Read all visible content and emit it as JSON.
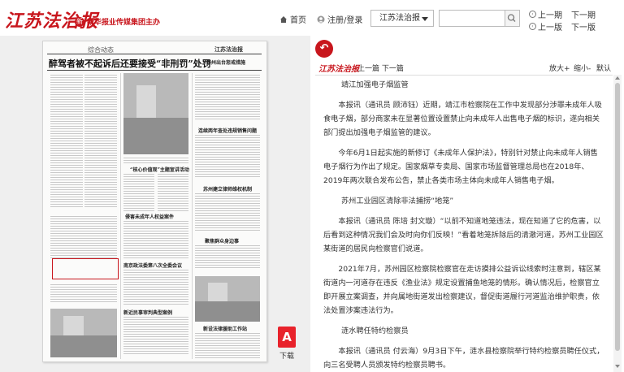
{
  "header": {
    "logo": "江苏法治报",
    "sublogo_seal": "新",
    "sublogo": "新华报业传媒集团主办",
    "home_label": "首页",
    "login_label": "注册/登录",
    "paper_select": "江苏法治报",
    "search_placeholder": "",
    "prev_issue": "上一期",
    "next_issue": "下一期",
    "prev_page": "上一版",
    "next_page": "下一版"
  },
  "newspaper": {
    "section": "综合动态",
    "brand": "江苏法治报",
    "headline": "醉驾者被不起诉后还要接受“非刑罚”处罚",
    "headline2": "泰州出台惩戒措施",
    "headline3": "连续两年查处违规销售问题",
    "headline4": "“核心价值观”主题宣讲活动",
    "headline5": "苏州建立律师维权机制",
    "headline6": "聚焦群众身边事",
    "headline7": "南京政法委第八次全委会议",
    "headline8": "侵害未成年人权益案件",
    "headline9": "新设法律援助工作站",
    "headline10": "新近民事审判典型案例"
  },
  "download": {
    "icon_glyph": "A",
    "label": "下载"
  },
  "article_toolbar": {
    "back_glyph": "↶",
    "logo": "江苏法治报",
    "prev_next": "上一篇 下一篇",
    "zoom_in": "放大+",
    "zoom_out": "缩小-",
    "default": "默认"
  },
  "article": {
    "paragraphs": [
      {
        "type": "sub",
        "text": "靖江加强电子烟监管"
      },
      {
        "type": "p",
        "text": "本报讯（通讯员 顾沛钰）近期，靖江市检察院在工作中发现部分涉罪未成年人吸食电子烟，部分商家未在显著位置设置禁止向未成年人出售电子烟的标识，遂向相关部门提出加强电子烟监管的建议。"
      },
      {
        "type": "p",
        "text": "今年6月1日起实施的新修订《未成年人保护法》，特别针对禁止向未成年人销售电子烟行为作出了规定。国家烟草专卖局、国家市场监督管理总局也在2018年、2019年两次联合发布公告，禁止各类市场主体向未成年人销售电子烟。"
      },
      {
        "type": "sub",
        "text": "苏州工业园区清除非法捕捞“地笼”"
      },
      {
        "type": "p",
        "text": "本报讯（通讯员 陈培 封文璇）“以前不知道地笼违法，现在知道了它的危害，以后看到这种情况我们会及时向你们反映！”看着地笼拆除后的清澈河道，苏州工业园区某街道的居民向检察官们说道。"
      },
      {
        "type": "p",
        "text": "2021年7月，苏州园区检察院检察官在走访摸排公益诉讼线索时注意到，辖区某街道内一河道存在违反《渔业法》规定设置捕鱼地笼的情形。确认情况后，检察官立即开展立案调查，并向属地街道发出检察建议，督促街道履行河道监治维护职责，依法处置涉案违法行为。"
      },
      {
        "type": "sub",
        "text": "涟水聘任特约检察员"
      },
      {
        "type": "p",
        "text": "本报讯（通讯员 付云海）9月3日下午，涟水县检察院举行特约检察员聘任仪式，向三名受聘人员颁发特约检察员聘书。"
      }
    ]
  }
}
